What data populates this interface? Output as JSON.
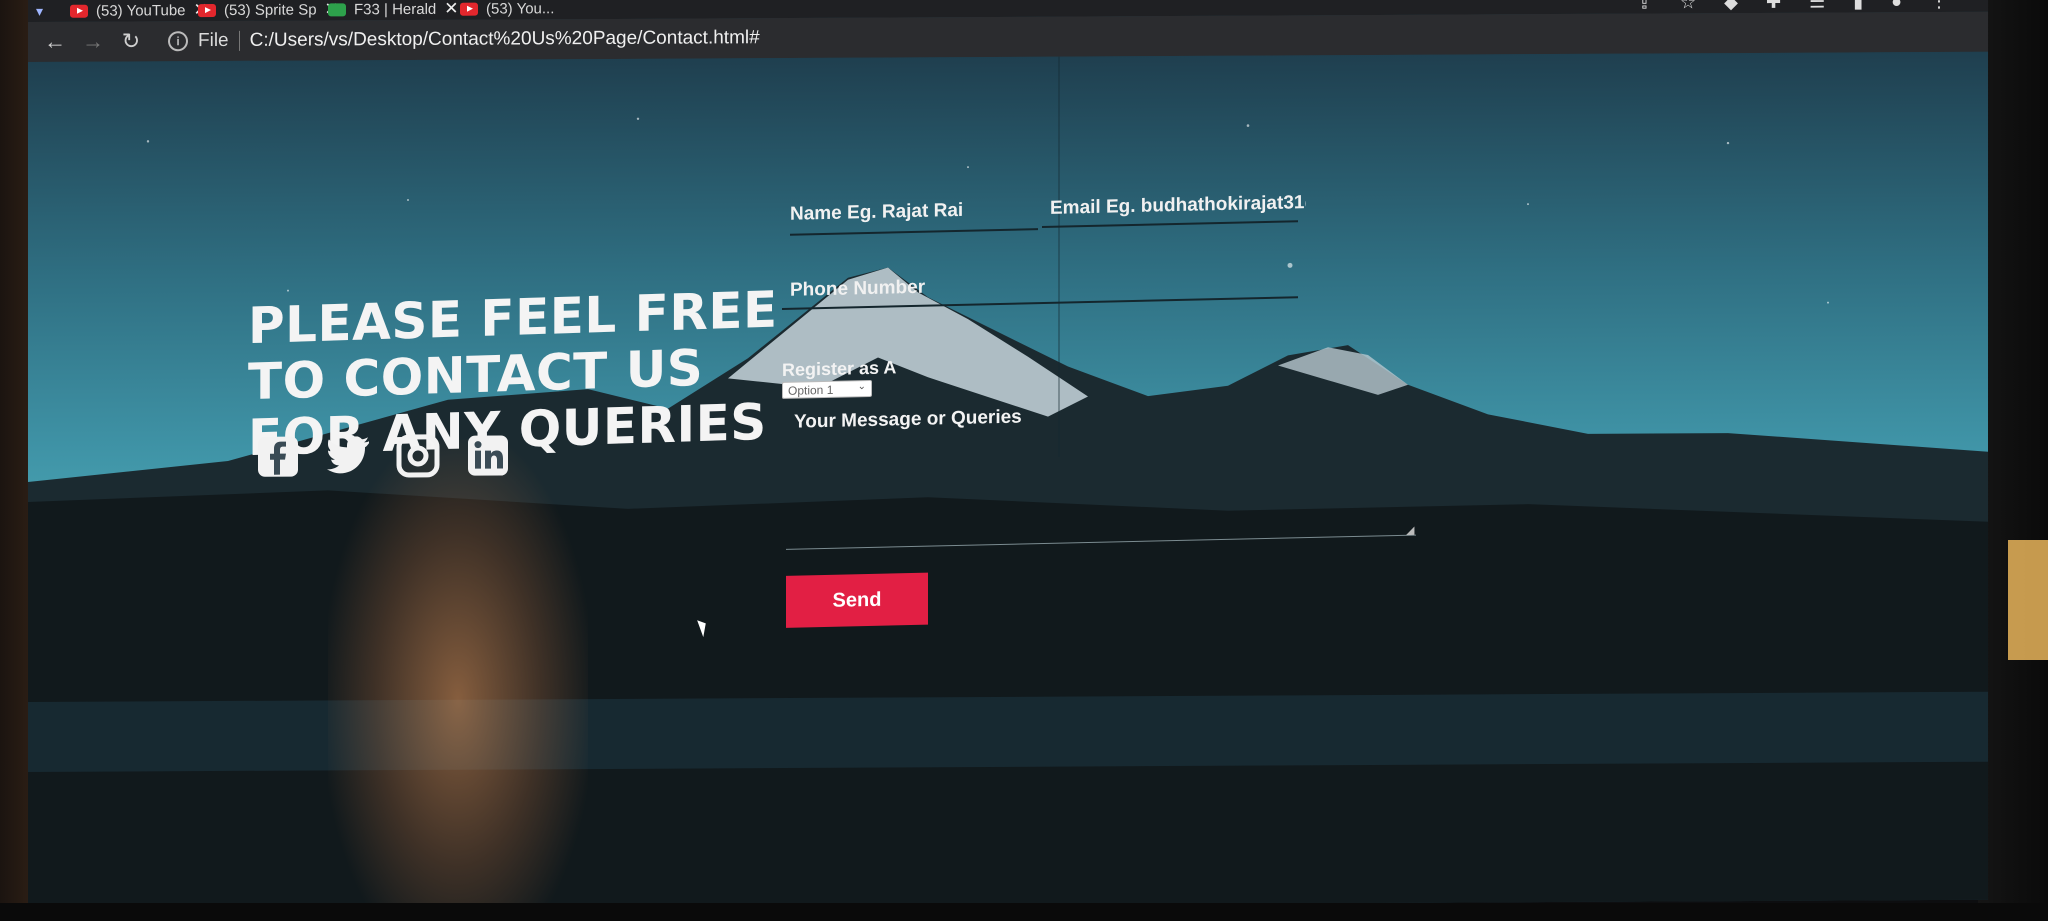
{
  "browser": {
    "tabs": [
      {
        "title": "(53) YouTube",
        "icon": "youtube-icon"
      },
      {
        "title": "(53) Sprite Sp",
        "icon": "youtube-icon"
      },
      {
        "title": "F33 | Herald",
        "icon": "sheets-icon"
      },
      {
        "title": "(53) You...",
        "icon": "youtube-icon"
      }
    ],
    "close_glyph": "✕",
    "file_label": "File",
    "url": "C:/Users/vs/Desktop/Contact%20Us%20Page/Contact.html#"
  },
  "page": {
    "headline": "PLEASE FEEL FREE TO CONTACT US FOR ANY QUERIES",
    "socials": [
      "facebook-icon",
      "twitter-icon",
      "instagram-icon",
      "linkedin-icon"
    ],
    "form": {
      "name_placeholder": "Name Eg. Rajat Rai",
      "email_placeholder": "Email Eg. budhathokirajat31@",
      "phone_placeholder": "Phone Number",
      "register_label": "Register as A",
      "register_selected": "Option 1",
      "message_placeholder": "Your Message or Queries",
      "send_label": "Send"
    }
  },
  "colors": {
    "send_button": "#e21f44",
    "sky_top": "#1f3f4f",
    "sky_mid": "#4aa5b3"
  }
}
